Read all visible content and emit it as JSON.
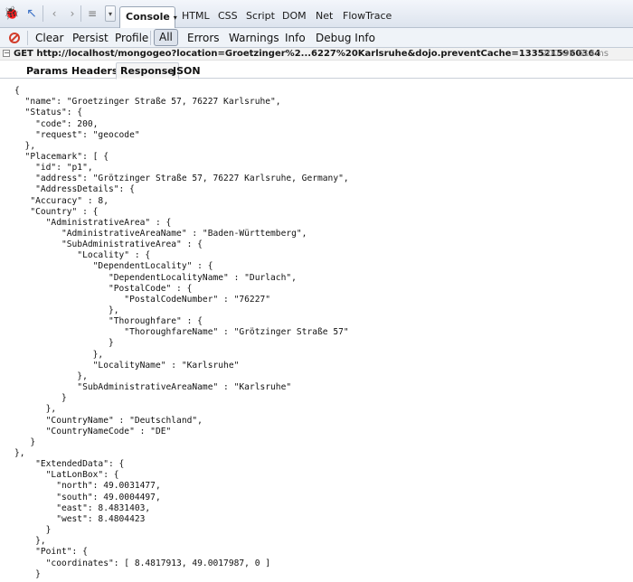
{
  "toolbar": {
    "tabs": [
      {
        "label": "Console",
        "active": true
      },
      {
        "label": "HTML"
      },
      {
        "label": "CSS"
      },
      {
        "label": "Script"
      },
      {
        "label": "DOM"
      },
      {
        "label": "Net"
      },
      {
        "label": "FlowTrace"
      }
    ],
    "dropdown_glyph": "▾",
    "icons": [
      "firebug-icon",
      "inspect-icon",
      "back-icon",
      "forward-icon",
      "list-icon"
    ]
  },
  "console_toolbar": {
    "buttons": [
      {
        "label": "Clear"
      },
      {
        "label": "Persist"
      },
      {
        "label": "Profile"
      },
      {
        "label": "All",
        "checked": true
      },
      {
        "label": "Errors"
      },
      {
        "label": "Warnings"
      },
      {
        "label": "Info"
      },
      {
        "label": "Debug Info"
      }
    ]
  },
  "request": {
    "text": "GET http://localhost/mongogeo?location=Groetzinger%2...6227%20Karlsruhe&dojo.preventCache=1335215960364",
    "status": "200 OK 614ms"
  },
  "subtabs": [
    {
      "label": "Params"
    },
    {
      "label": "Headers"
    },
    {
      "label": "Response",
      "active": true
    },
    {
      "label": "JSON"
    }
  ],
  "response_lines": [
    "{",
    "  \"name\": \"Groetzinger Straße 57, 76227 Karlsruhe\",",
    "  \"Status\": {",
    "    \"code\": 200,",
    "    \"request\": \"geocode\"",
    "  },",
    "  \"Placemark\": [ {",
    "    \"id\": \"p1\",",
    "    \"address\": \"Grötzinger Straße 57, 76227 Karlsruhe, Germany\",",
    "    \"AddressDetails\": {",
    "   \"Accuracy\" : 8,",
    "   \"Country\" : {",
    "      \"AdministrativeArea\" : {",
    "         \"AdministrativeAreaName\" : \"Baden-Württemberg\",",
    "         \"SubAdministrativeArea\" : {",
    "            \"Locality\" : {",
    "               \"DependentLocality\" : {",
    "                  \"DependentLocalityName\" : \"Durlach\",",
    "                  \"PostalCode\" : {",
    "                     \"PostalCodeNumber\" : \"76227\"",
    "                  },",
    "                  \"Thoroughfare\" : {",
    "                     \"ThoroughfareName\" : \"Grötzinger Straße 57\"",
    "                  }",
    "               },",
    "               \"LocalityName\" : \"Karlsruhe\"",
    "            },",
    "            \"SubAdministrativeAreaName\" : \"Karlsruhe\"",
    "         }",
    "      },",
    "      \"CountryName\" : \"Deutschland\",",
    "      \"CountryNameCode\" : \"DE\"",
    "   }",
    "},",
    "    \"ExtendedData\": {",
    "      \"LatLonBox\": {",
    "        \"north\": 49.0031477,",
    "        \"south\": 49.0004497,",
    "        \"east\": 8.4831403,",
    "        \"west\": 8.4804423",
    "      }",
    "    },",
    "    \"Point\": {",
    "      \"coordinates\": [ 8.4817913, 49.0017987, 0 ]",
    "    }"
  ]
}
